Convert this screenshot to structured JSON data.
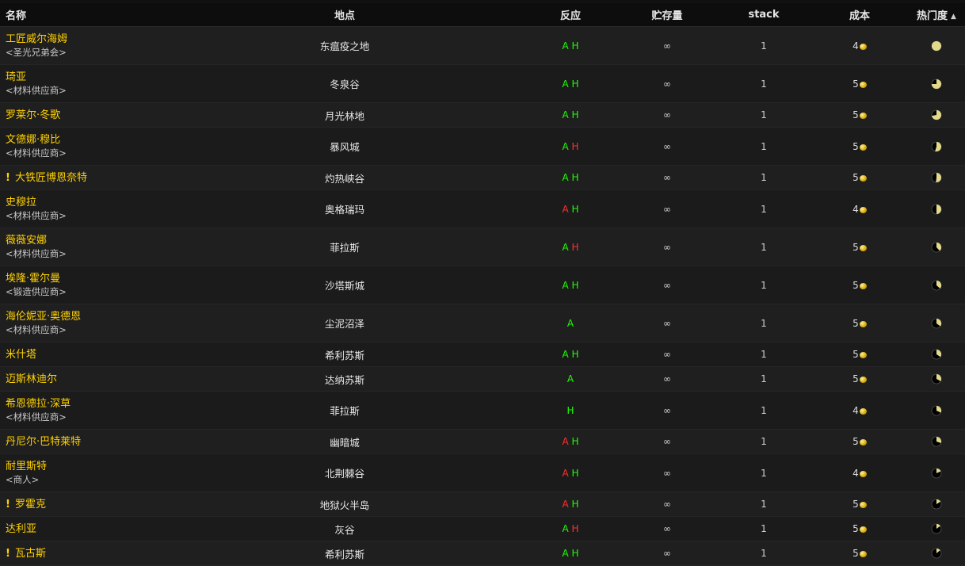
{
  "header": {
    "name": "名称",
    "location": "地点",
    "reaction": "反应",
    "stock": "贮存量",
    "stack": "stack",
    "cost": "成本",
    "popularity": "热门度"
  },
  "colors": {
    "name": "#ffd100",
    "alliance_ok": "#1eff00",
    "horde_hostile": "#ff3030",
    "pie_fill": "#e3d98a"
  },
  "rows": [
    {
      "name": "工匠威尔海姆",
      "subtitle": "<圣光兄弟会>",
      "quest": false,
      "location": "东瘟疫之地",
      "a": "A",
      "a_color": "green",
      "h": "H",
      "h_color": "green",
      "stock": "∞",
      "stack": "1",
      "cost": "4",
      "popularity": 1.0
    },
    {
      "name": "琦亚",
      "subtitle": "<材料供应商>",
      "quest": false,
      "location": "冬泉谷",
      "a": "A",
      "a_color": "green",
      "h": "H",
      "h_color": "green",
      "stock": "∞",
      "stack": "1",
      "cost": "5",
      "popularity": 0.75
    },
    {
      "name": "罗莱尔·冬歌",
      "subtitle": "",
      "quest": false,
      "location": "月光林地",
      "a": "A",
      "a_color": "green",
      "h": "H",
      "h_color": "green",
      "stock": "∞",
      "stack": "1",
      "cost": "5",
      "popularity": 0.72
    },
    {
      "name": "文德娜·穆比",
      "subtitle": "<材料供应商>",
      "quest": false,
      "location": "暴风城",
      "a": "A",
      "a_color": "green",
      "h": "H",
      "h_color": "red",
      "stock": "∞",
      "stack": "1",
      "cost": "5",
      "popularity": 0.55
    },
    {
      "name": "大铁匠博恩奈特",
      "subtitle": "",
      "quest": true,
      "location": "灼热峡谷",
      "a": "A",
      "a_color": "green",
      "h": "H",
      "h_color": "green",
      "stock": "∞",
      "stack": "1",
      "cost": "5",
      "popularity": 0.52
    },
    {
      "name": "史穆拉",
      "subtitle": "<材料供应商>",
      "quest": false,
      "location": "奥格瑞玛",
      "a": "A",
      "a_color": "red",
      "h": "H",
      "h_color": "green",
      "stock": "∞",
      "stack": "1",
      "cost": "4",
      "popularity": 0.5
    },
    {
      "name": "薇薇安娜",
      "subtitle": "<材料供应商>",
      "quest": false,
      "location": "菲拉斯",
      "a": "A",
      "a_color": "green",
      "h": "H",
      "h_color": "red",
      "stock": "∞",
      "stack": "1",
      "cost": "5",
      "popularity": 0.38
    },
    {
      "name": "埃隆·霍尔曼",
      "subtitle": "<锻造供应商>",
      "quest": false,
      "location": "沙塔斯城",
      "a": "A",
      "a_color": "green",
      "h": "H",
      "h_color": "green",
      "stock": "∞",
      "stack": "1",
      "cost": "5",
      "popularity": 0.36
    },
    {
      "name": "海伦妮亚·奥德恩",
      "subtitle": "<材料供应商>",
      "quest": false,
      "location": "尘泥沼泽",
      "a": "A",
      "a_color": "green",
      "h": "",
      "h_color": "green",
      "stock": "∞",
      "stack": "1",
      "cost": "5",
      "popularity": 0.35
    },
    {
      "name": "米什塔",
      "subtitle": "",
      "quest": false,
      "location": "希利苏斯",
      "a": "A",
      "a_color": "green",
      "h": "H",
      "h_color": "green",
      "stock": "∞",
      "stack": "1",
      "cost": "5",
      "popularity": 0.34
    },
    {
      "name": "迈斯林迪尔",
      "subtitle": "",
      "quest": false,
      "location": "达纳苏斯",
      "a": "A",
      "a_color": "green",
      "h": "",
      "h_color": "green",
      "stock": "∞",
      "stack": "1",
      "cost": "5",
      "popularity": 0.33
    },
    {
      "name": "希恩德拉·深草",
      "subtitle": "<材料供应商>",
      "quest": false,
      "location": "菲拉斯",
      "a": "",
      "a_color": "green",
      "h": "H",
      "h_color": "green",
      "stock": "∞",
      "stack": "1",
      "cost": "4",
      "popularity": 0.32
    },
    {
      "name": "丹尼尔·巴特莱特",
      "subtitle": "",
      "quest": false,
      "location": "幽暗城",
      "a": "A",
      "a_color": "red",
      "h": "H",
      "h_color": "green",
      "stock": "∞",
      "stack": "1",
      "cost": "5",
      "popularity": 0.3
    },
    {
      "name": "耐里斯特",
      "subtitle": "<商人>",
      "quest": false,
      "location": "北荆棘谷",
      "a": "A",
      "a_color": "red",
      "h": "H",
      "h_color": "green",
      "stock": "∞",
      "stack": "1",
      "cost": "4",
      "popularity": 0.18
    },
    {
      "name": "罗霍克",
      "subtitle": "",
      "quest": true,
      "location": "地狱火半岛",
      "a": "A",
      "a_color": "red",
      "h": "H",
      "h_color": "green",
      "stock": "∞",
      "stack": "1",
      "cost": "5",
      "popularity": 0.16
    },
    {
      "name": "达利亚",
      "subtitle": "",
      "quest": false,
      "location": "灰谷",
      "a": "A",
      "a_color": "green",
      "h": "H",
      "h_color": "red",
      "stock": "∞",
      "stack": "1",
      "cost": "5",
      "popularity": 0.15
    },
    {
      "name": "瓦古斯",
      "subtitle": "",
      "quest": true,
      "location": "希利苏斯",
      "a": "A",
      "a_color": "green",
      "h": "H",
      "h_color": "green",
      "stock": "∞",
      "stack": "1",
      "cost": "5",
      "popularity": 0.14
    }
  ]
}
